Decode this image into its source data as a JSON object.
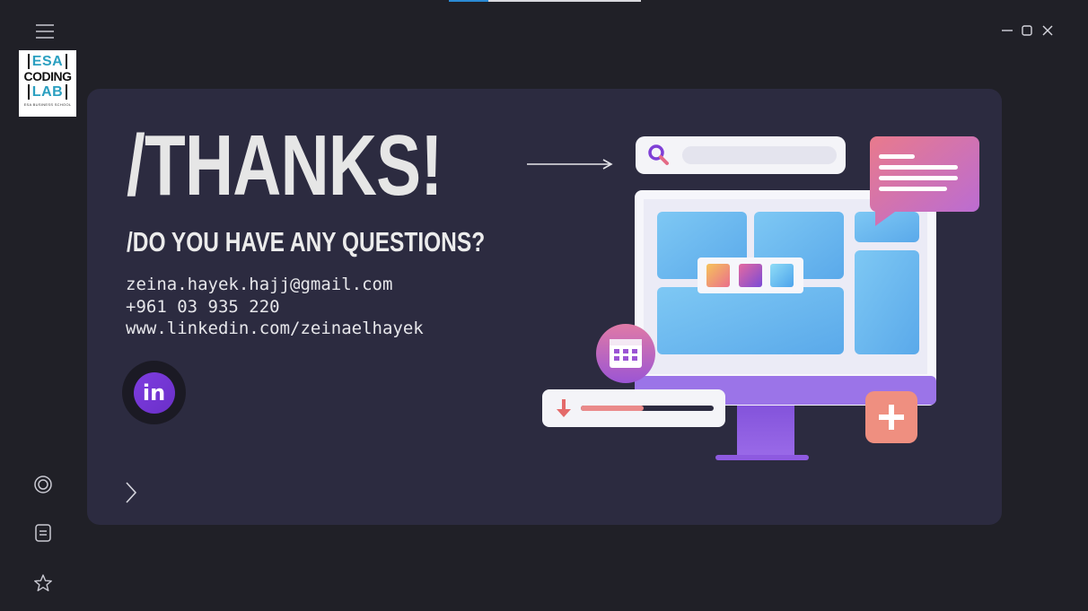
{
  "window": {
    "controls": {
      "minimize_icon": "minimize-icon",
      "maximize_icon": "maximize-icon",
      "close_icon": "close-icon"
    }
  },
  "sidebar": {
    "menu_icon": "hamburger-icon",
    "logo": {
      "line1": "ESA",
      "line2": "CODING",
      "line3": "LAB",
      "tagline": "ESA BUSINESS SCHOOL"
    },
    "bottom_icons": [
      "target-icon",
      "notes-icon",
      "star-icon"
    ]
  },
  "slide": {
    "title": "/THANKS!",
    "subtitle": "/DO YOU HAVE ANY QUESTIONS?",
    "email": "zeina.hayek.hajj@gmail.com",
    "phone": "+961 03 935 220",
    "linkedin": "www.linkedin.com/zeinaelhayek",
    "linkedin_badge": "in",
    "next_icon": "chevron-right-icon"
  },
  "colors": {
    "background": "#202027",
    "slide_bg": "#2c2b40",
    "accent_purple": "#7e3de0",
    "accent_pink": "#e07a8a",
    "screen_blue": "#7ec8f4"
  }
}
